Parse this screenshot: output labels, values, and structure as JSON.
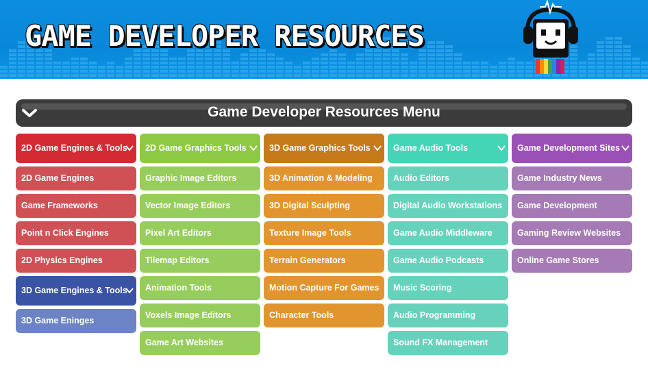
{
  "banner": {
    "title": "GAME DEVELOPER RESOURCES",
    "mascot_icon": "robot-headphones-mascot-icon",
    "colors": {
      "background": "#0a87d8"
    }
  },
  "menu": {
    "title": "Game Developer Resources Menu",
    "toggle_icon": "chevron-down-icon",
    "background": "#3b3b3b"
  },
  "columns": [
    {
      "groups": [
        {
          "heading": "2D Game Engines & Tools",
          "color": "#d42a34",
          "items": [
            "2D Game Engines",
            "Game Frameworks",
            "Point n Click Engines",
            "2D Physics Engines"
          ]
        },
        {
          "heading": "3D Game Engines & Tools",
          "color": "#3a53a4",
          "items": [
            "3D Game Eninges"
          ]
        }
      ]
    },
    {
      "groups": [
        {
          "heading": "2D Game Graphics Tools",
          "color": "#8dc943",
          "items": [
            "Graphic Image Editors",
            "Vector Image Editors",
            "Pixel Art Editors",
            "Tilemap Editors",
            "Animation Tools",
            "Voxels Image Editors",
            "Game Art Websites"
          ]
        }
      ]
    },
    {
      "groups": [
        {
          "heading": "3D Game Graphics Tools",
          "color": "#c77a19",
          "items": [
            "3D Animation & Modeling",
            "3D Digital Sculpting",
            "Texture Image Tools",
            "Terrain Generators",
            "Motion Capture For Games",
            "Character Tools"
          ]
        }
      ]
    },
    {
      "groups": [
        {
          "heading": "Game Audio Tools",
          "color": "#43d5b6",
          "items": [
            "Audio Editors",
            "Digital Audio Workstations",
            "Game Audio Middleware",
            "Game Audio Podcasts",
            "Music Scoring",
            "Audio Programming",
            "Sound FX Management"
          ]
        }
      ]
    },
    {
      "groups": [
        {
          "heading": "Game Development Sites",
          "color": "#9b50b7",
          "items": [
            "Game Industry News",
            "Game Development",
            "Gaming Review Websites",
            "Online Game Stores"
          ]
        }
      ]
    }
  ]
}
